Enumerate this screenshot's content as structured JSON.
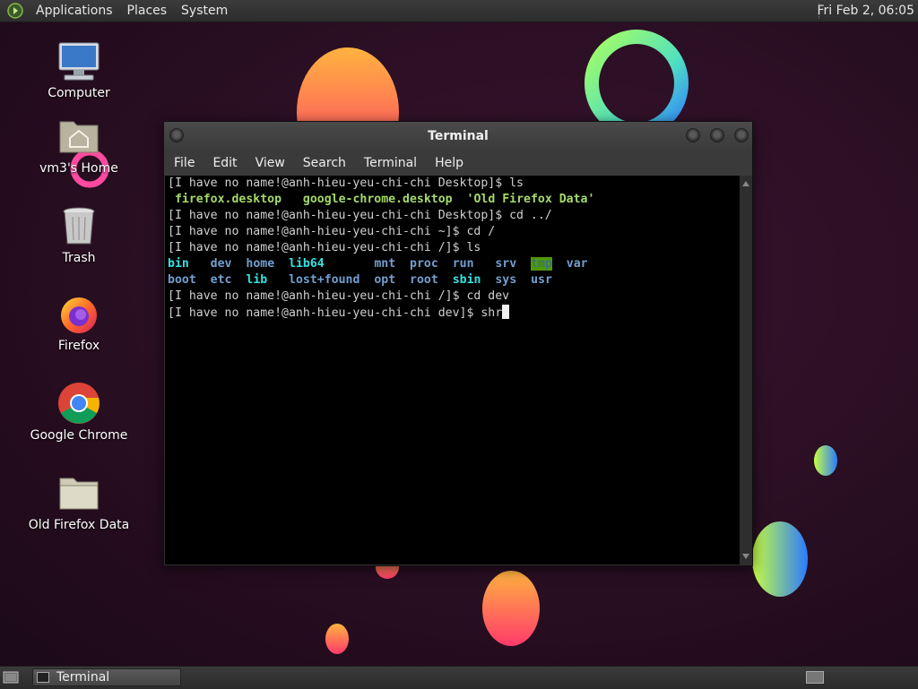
{
  "top_panel": {
    "menus": [
      "Applications",
      "Places",
      "System"
    ],
    "clock": "Fri Feb  2, 06:05"
  },
  "desktop": {
    "icons": [
      {
        "label": "Computer",
        "icon": "computer-icon"
      },
      {
        "label": "vm3's Home",
        "icon": "home-folder-icon"
      },
      {
        "label": "Trash",
        "icon": "trash-icon"
      },
      {
        "label": "Firefox",
        "icon": "firefox-icon"
      },
      {
        "label": "Google Chrome",
        "icon": "chrome-icon"
      },
      {
        "label": "Old Firefox Data",
        "icon": "folder-icon"
      }
    ]
  },
  "terminal": {
    "title": "Terminal",
    "menu": [
      "File",
      "Edit",
      "View",
      "Search",
      "Terminal",
      "Help"
    ],
    "lines": {
      "l1": "[I have no name!@anh-hieu-yeu-chi-chi Desktop]$ ls",
      "l2a": "firefox.desktop",
      "l2b": "google-chrome.desktop",
      "l2c": "'Old Firefox Data'",
      "l3": "[I have no name!@anh-hieu-yeu-chi-chi Desktop]$ cd ../",
      "l4": "[I have no name!@anh-hieu-yeu-chi-chi ~]$ cd /",
      "l5": "[I have no name!@anh-hieu-yeu-chi-chi /]$ ls",
      "l8": "[I have no name!@anh-hieu-yeu-chi-chi /]$ cd dev",
      "l9": "[I have no name!@anh-hieu-yeu-chi-chi dev]$ shr"
    },
    "ls_root_row1": [
      "bin",
      "dev",
      "home",
      "lib64",
      "mnt",
      "proc",
      "run",
      "srv",
      "tmp",
      "var"
    ],
    "ls_root_row2": [
      "boot",
      "etc",
      "lib",
      "lost+found",
      "opt",
      "root",
      "sbin",
      "sys",
      "usr"
    ]
  },
  "bottom_panel": {
    "task": "Terminal"
  },
  "colors": {
    "wallpaper_bg": "#2a0f22",
    "terminal_bg": "#000000",
    "dir_blue": "#729fcf",
    "exec_green": "#8ae234"
  }
}
